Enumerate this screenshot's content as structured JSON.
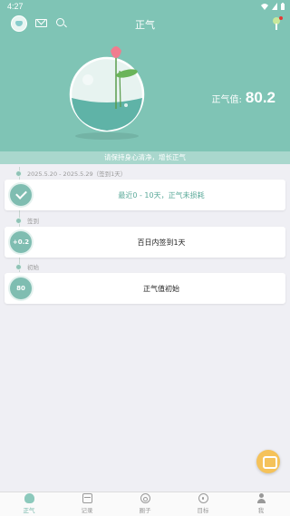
{
  "status": {
    "time": "4:27"
  },
  "header": {
    "title": "正气"
  },
  "hero": {
    "value_label": "正气值:",
    "value": "80.2",
    "slogan": "请保持身心清净，增长正气"
  },
  "sections": [
    {
      "label": "2025.5.20 - 2025.5.29（签到1天）",
      "badge": "",
      "text": "最近0 - 10天，正气未损耗",
      "accent": true
    },
    {
      "label": "签到",
      "badge": "+0.2",
      "text": "百日内签到1天",
      "accent": false
    },
    {
      "label": "初始",
      "badge": "80",
      "text": "正气值初始",
      "accent": false
    }
  ],
  "tabs": [
    {
      "label": "正气",
      "icon": "qi-icon",
      "active": true
    },
    {
      "label": "记录",
      "icon": "record-icon",
      "active": false
    },
    {
      "label": "圈子",
      "icon": "circle-icon",
      "active": false
    },
    {
      "label": "目标",
      "icon": "target-icon",
      "active": false
    },
    {
      "label": "我",
      "icon": "profile-icon",
      "active": false
    }
  ],
  "colors": {
    "primary": "#7fc4b5",
    "accent": "#5aa999",
    "fab": "#f5c25a",
    "notification": "#e53935"
  }
}
